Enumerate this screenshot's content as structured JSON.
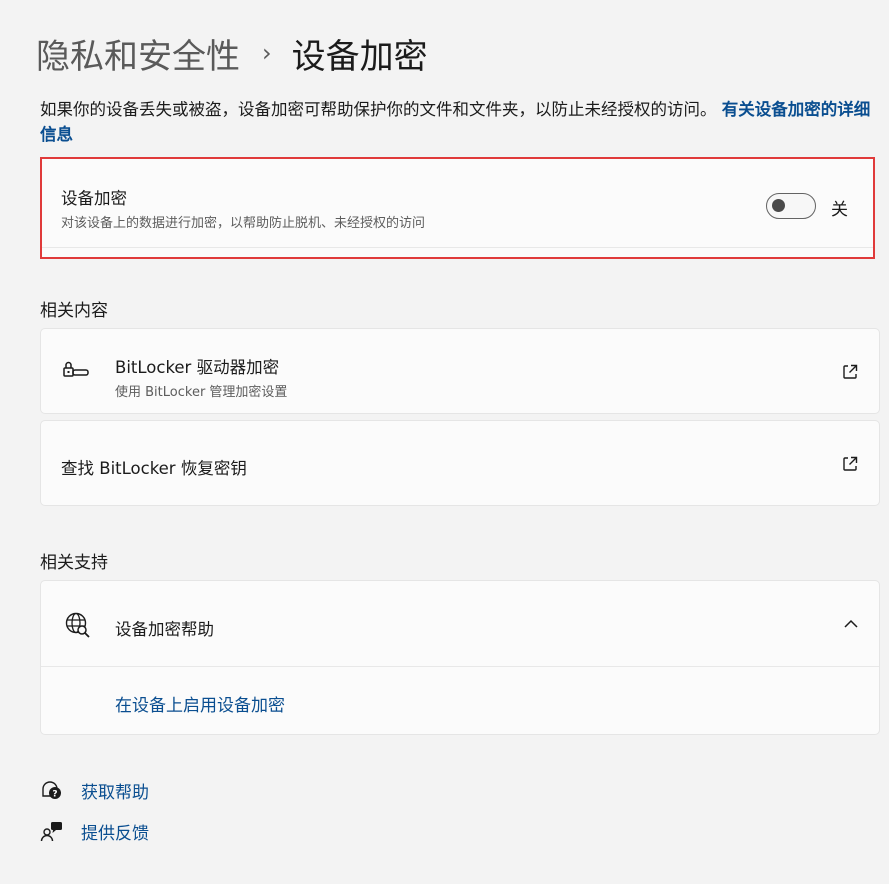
{
  "breadcrumb": {
    "parent": "隐私和安全性",
    "separator": "›",
    "current": "设备加密"
  },
  "intro": {
    "text": "如果你的设备丢失或被盗，设备加密可帮助保护你的文件和文件夹，以防止未经授权的访问。",
    "link": "有关设备加密的详细信息"
  },
  "encryption_setting": {
    "title": "设备加密",
    "description": "对该设备上的数据进行加密，以帮助防止脱机、未经授权的访问",
    "toggle_state": "关",
    "toggle_on": false
  },
  "related_content": {
    "heading": "相关内容",
    "items": [
      {
        "title": "BitLocker 驱动器加密",
        "subtitle": "使用 BitLocker 管理加密设置",
        "icon": "bitlocker-key-icon"
      },
      {
        "title": "查找 BitLocker 恢复密钥",
        "icon": "external-link-icon"
      }
    ]
  },
  "related_support": {
    "heading": "相关支持",
    "help_title": "设备加密帮助",
    "help_icon": "globe-search-icon",
    "expanded": true,
    "links": [
      "在设备上启用设备加密"
    ]
  },
  "footer": {
    "get_help": "获取帮助",
    "feedback": "提供反馈"
  },
  "colors": {
    "accent_link": "#0a4e90",
    "highlight_border": "#e03a3a",
    "background": "#f3f3f3",
    "card": "#fbfbfb"
  }
}
